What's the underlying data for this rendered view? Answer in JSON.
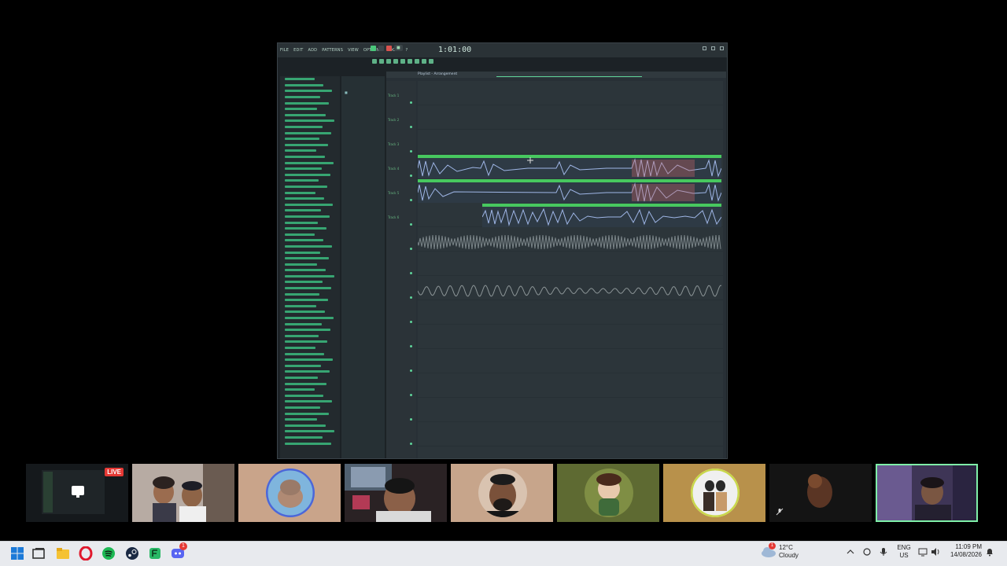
{
  "fl_studio": {
    "menus": [
      "FILE",
      "EDIT",
      "ADD",
      "PATTERNS",
      "VIEW",
      "OPTIONS",
      "TOOLS",
      "?"
    ],
    "time_display": "1:01:00",
    "playlist_title": "Playlist - Arrangement",
    "tracks": [
      {
        "label": "Track 1"
      },
      {
        "label": "Track 2"
      },
      {
        "label": "Track 3"
      },
      {
        "label": "Track 4"
      },
      {
        "label": "Track 5"
      },
      {
        "label": "Track 6"
      }
    ]
  },
  "call": {
    "live_badge": "LIVE",
    "participants": [
      {
        "kind": "screen-share",
        "bg": "#15191c"
      },
      {
        "kind": "camera",
        "bg": "#8a7f78"
      },
      {
        "kind": "avatar",
        "bg": "#c9a48a"
      },
      {
        "kind": "camera",
        "bg": "#3a2f2c"
      },
      {
        "kind": "avatar",
        "bg": "#c7a58b"
      },
      {
        "kind": "avatar",
        "bg": "#5e6a32"
      },
      {
        "kind": "avatar",
        "bg": "#b8914b"
      },
      {
        "kind": "avatar",
        "bg": "#151515"
      },
      {
        "kind": "camera",
        "bg": "#4c3f66"
      }
    ]
  },
  "taskbar": {
    "weather_badge": "1",
    "weather_temp": "12°C",
    "weather_cond": "Cloudy",
    "lang_top": "ENG",
    "lang_bottom": "US",
    "time": "11:09 PM",
    "date": "14/08/2026",
    "discord_badge": "1"
  }
}
